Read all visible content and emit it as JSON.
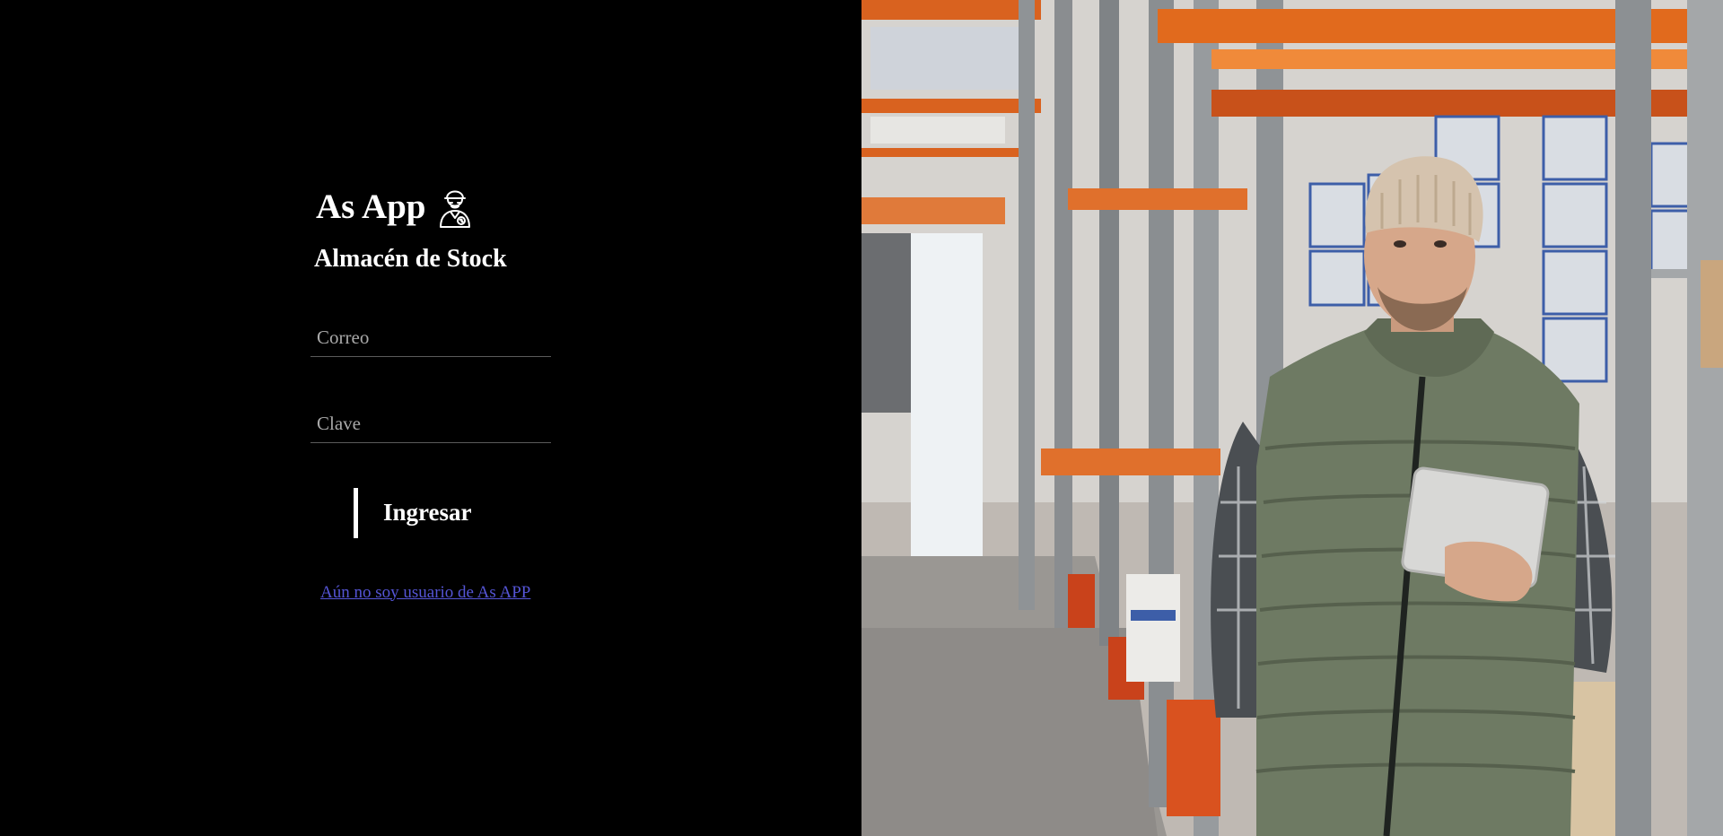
{
  "app": {
    "title": "As App",
    "logo_icon": "worker-icon",
    "subtitle": "Almacén de Stock"
  },
  "form": {
    "email_placeholder": "Correo",
    "email_value": "",
    "password_placeholder": "Clave",
    "password_value": "",
    "submit_label": "Ingresar",
    "register_link": "Aún no soy usuario de As APP"
  },
  "colors": {
    "background": "#000000",
    "text": "#ffffff",
    "link": "#5555d6",
    "placeholder": "#a9a9a9"
  },
  "hero_image": {
    "icon": "warehouse-worker-photo"
  }
}
